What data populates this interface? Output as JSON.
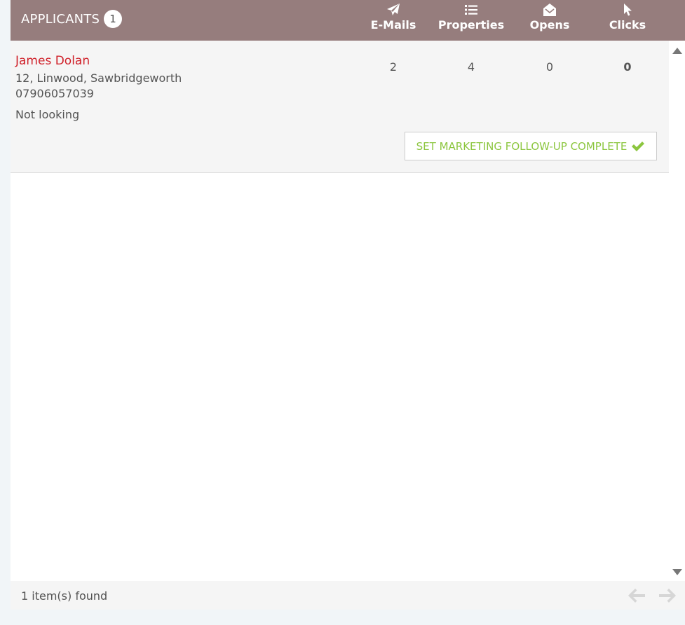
{
  "header": {
    "title": "APPLICANTS",
    "count": "1",
    "columns": [
      {
        "label": "E-Mails",
        "icon": "paper-plane-icon"
      },
      {
        "label": "Properties",
        "icon": "list-icon"
      },
      {
        "label": "Opens",
        "icon": "open-envelope-icon"
      },
      {
        "label": "Clicks",
        "icon": "cursor-icon"
      }
    ]
  },
  "applicants": [
    {
      "name": "James Dolan",
      "address": "12, Linwood, Sawbridgeworth",
      "phone": "07906057039",
      "status": "Not looking",
      "emails": "2",
      "properties": "4",
      "opens": "0",
      "clicks": "0",
      "followup_label": "SET MARKETING FOLLOW-UP COMPLETE"
    }
  ],
  "footer": {
    "found_text": "1 item(s) found"
  },
  "colors": {
    "header_bg": "#967d7d",
    "name": "#d0212a",
    "followup": "#8cc63f"
  }
}
